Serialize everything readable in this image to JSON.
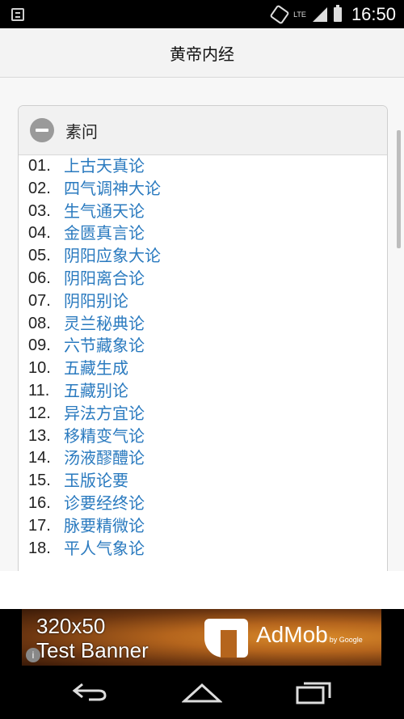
{
  "status_bar": {
    "time": "16:50",
    "network": "LTE"
  },
  "header": {
    "title": "黄帝内经"
  },
  "section": {
    "title": "素问",
    "chapters": [
      {
        "num": "01.",
        "title": "上古天真论"
      },
      {
        "num": "02.",
        "title": "四气调神大论"
      },
      {
        "num": "03.",
        "title": "生气通天论"
      },
      {
        "num": "04.",
        "title": "金匮真言论"
      },
      {
        "num": "05.",
        "title": "阴阳应象大论"
      },
      {
        "num": "06.",
        "title": "阴阳离合论"
      },
      {
        "num": "07.",
        "title": "阴阳别论"
      },
      {
        "num": "08.",
        "title": "灵兰秘典论"
      },
      {
        "num": "09.",
        "title": "六节藏象论"
      },
      {
        "num": "10.",
        "title": "五藏生成"
      },
      {
        "num": "11.",
        "title": "五藏别论"
      },
      {
        "num": "12.",
        "title": "异法方宜论"
      },
      {
        "num": "13.",
        "title": "移精变气论"
      },
      {
        "num": "14.",
        "title": "汤液醪醴论"
      },
      {
        "num": "15.",
        "title": "玉版论要"
      },
      {
        "num": "16.",
        "title": "诊要经终论"
      },
      {
        "num": "17.",
        "title": "脉要精微论"
      },
      {
        "num": "18.",
        "title": "平人气象论"
      }
    ]
  },
  "ad": {
    "line1": "320x50",
    "line2": "Test Banner",
    "brand": "AdMob",
    "by": "by Google"
  },
  "colors": {
    "link": "#2a7abf",
    "header_bg": "#f3f3f3"
  }
}
